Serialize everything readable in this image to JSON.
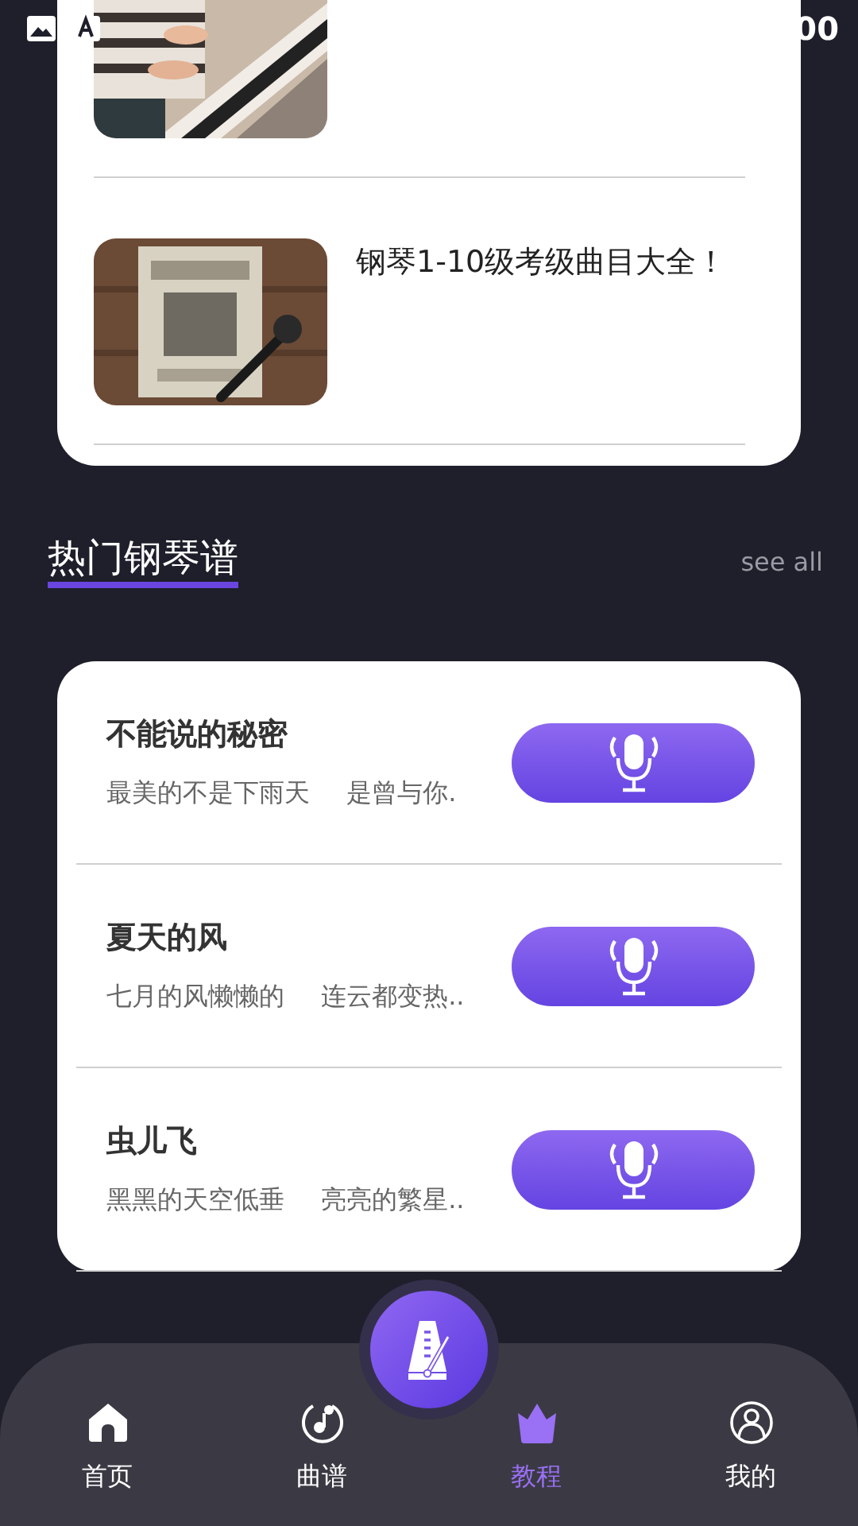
{
  "status_bar": {
    "time": "00"
  },
  "articles": [
    {
      "kind": "picture"
    },
    {
      "kind": "picture",
      "title": "钢琴1-10级考级曲目大全！"
    }
  ],
  "section": {
    "title": "热门钢琴谱",
    "link": "see all"
  },
  "songs": [
    {
      "title": "不能说的秘密",
      "lyric": "最美的不是下雨天 是曾与你."
    },
    {
      "title": "夏天的风",
      "lyric": "七月的风懒懒的 连云都变热.."
    },
    {
      "title": "虫儿飞",
      "lyric": "黑黑的天空低垂 亮亮的繁星.."
    }
  ],
  "tabs": [
    {
      "label": "首页",
      "selected": false
    },
    {
      "label": "曲谱",
      "selected": false
    },
    {
      "label": "教程",
      "selected": true
    },
    {
      "label": "我的",
      "selected": false
    }
  ]
}
